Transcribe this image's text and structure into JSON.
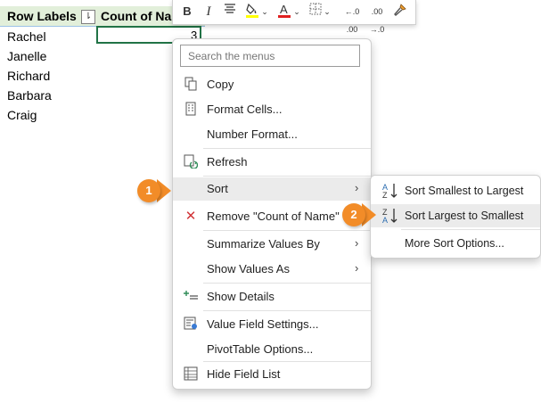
{
  "pivot": {
    "header_row_labels": "Row Labels",
    "header_count": "Count of Na",
    "filter_glyph": "⇂",
    "rows": [
      "Rachel",
      "Janelle",
      "Richard",
      "Barbara",
      "Craig"
    ],
    "selected_cell_value": "3"
  },
  "mini_toolbar": {
    "bold": "B",
    "italic": "I",
    "increase_decimal": "←.0 .00",
    "decrease_decimal": ".00 →.0"
  },
  "context_menu": {
    "search_placeholder": "Search the menus",
    "items": [
      {
        "label": "Copy",
        "icon": "copy-icon"
      },
      {
        "label": "Format Cells...",
        "icon": "format-cells-icon"
      },
      {
        "label": "Number Format...",
        "icon": ""
      },
      {
        "label": "Refresh",
        "icon": "refresh-icon"
      },
      {
        "label": "Sort",
        "icon": "",
        "has_submenu": true
      },
      {
        "label": "Remove \"Count of Name\"",
        "icon": "remove-x-icon"
      },
      {
        "label": "Summarize Values By",
        "icon": "",
        "has_submenu": true
      },
      {
        "label": "Show Values As",
        "icon": "",
        "has_submenu": true
      },
      {
        "label": "Show Details",
        "icon": "show-details-icon"
      },
      {
        "label": "Value Field Settings...",
        "icon": "value-field-settings-icon"
      },
      {
        "label": "PivotTable Options...",
        "icon": ""
      },
      {
        "label": "Hide Field List",
        "icon": "field-list-icon"
      }
    ]
  },
  "sort_submenu": {
    "items": [
      {
        "label": "Sort Smallest to Largest",
        "icon": "sort-ascending-icon"
      },
      {
        "label": "Sort Largest to Smallest",
        "icon": "sort-descending-icon"
      },
      {
        "label": "More Sort Options...",
        "icon": ""
      }
    ]
  },
  "callouts": [
    "1",
    "2"
  ],
  "colors": {
    "header_fill": "#e2efda",
    "selection_border": "#217346",
    "callout": "#f28c28",
    "remove_icon": "#d13438",
    "hover": "#ebebeb"
  }
}
